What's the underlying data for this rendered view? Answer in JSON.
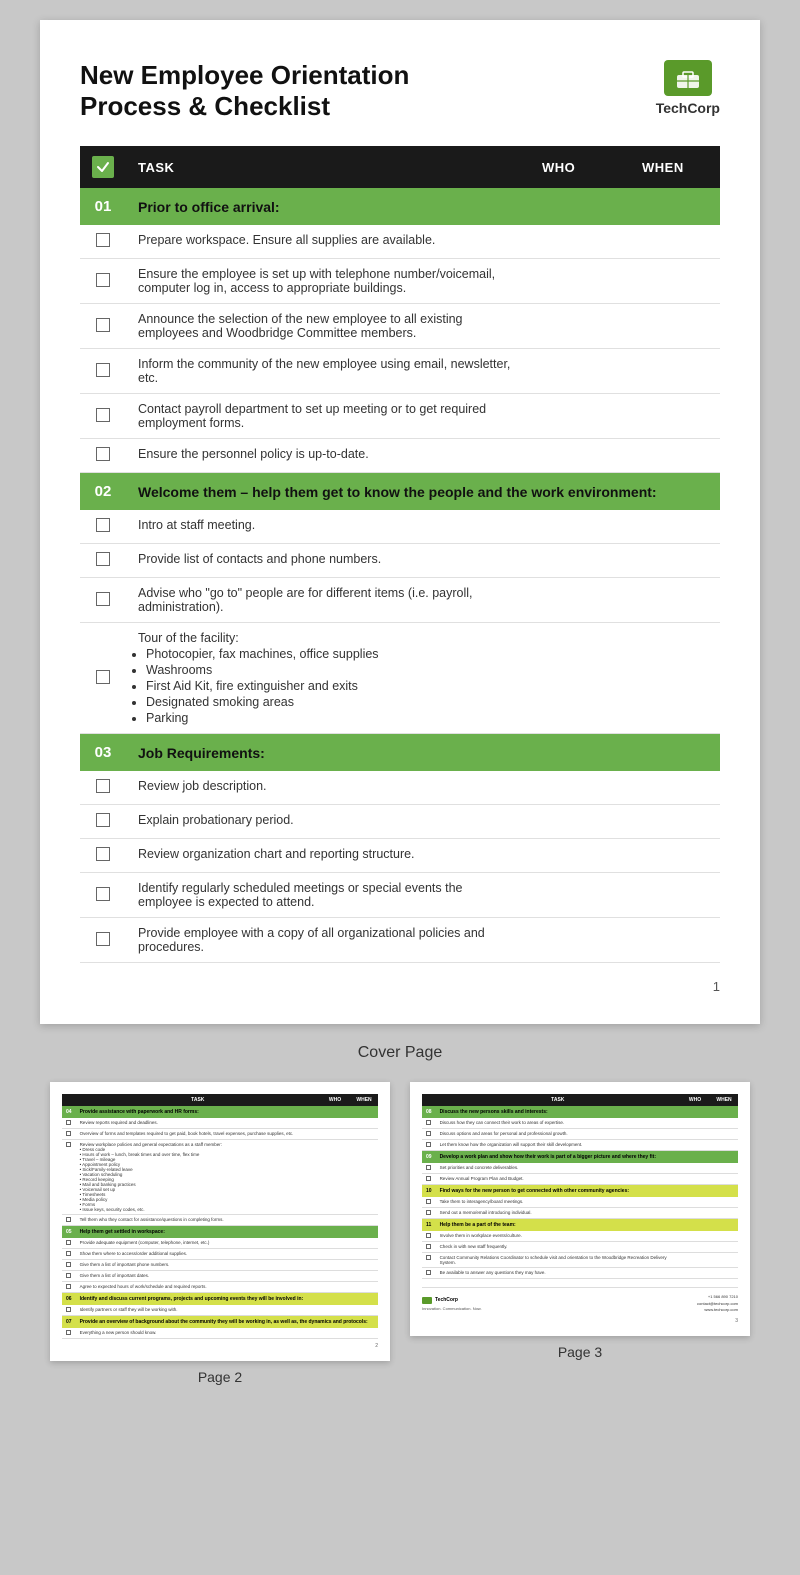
{
  "header": {
    "title_line1": "New Employee Orientation",
    "title_line2": "Process & Checklist",
    "logo_name": "TechCorp",
    "logo_alt": "briefcase-icon"
  },
  "table": {
    "columns": [
      "check",
      "TASK",
      "WHO",
      "WHEN"
    ],
    "sections": [
      {
        "id": "01",
        "title": "Prior to office arrival:",
        "rows": [
          "Prepare workspace. Ensure all supplies are available.",
          "Ensure the employee is set up with telephone number/voicemail, computer log in, access to appropriate buildings.",
          "Announce the selection of the new employee to all existing employees and Woodbridge Committee members.",
          "Inform the community of the new employee using email, newsletter, etc.",
          "Contact payroll department to set up meeting or to get required employment forms.",
          "Ensure the personnel policy is up-to-date."
        ]
      },
      {
        "id": "02",
        "title": "Welcome them – help them get to know the people and the work environment:",
        "rows": [
          "Intro at staff meeting.",
          "Provide list of contacts and phone numbers.",
          "Advise who \"go to\" people are for different items (i.e. payroll, administration).",
          "tour"
        ]
      },
      {
        "id": "03",
        "title": "Job Requirements:",
        "rows": [
          "Review job description.",
          "Explain probationary period.",
          "Review organization chart and reporting structure.",
          "Identify regularly scheduled meetings or special events the employee is expected to attend.",
          "Provide employee with a copy of all organizational policies and procedures."
        ]
      }
    ],
    "tour_row": {
      "main": "Tour of the facility:",
      "bullets": [
        "Photocopier, fax machines, office supplies",
        "Washrooms",
        "First Aid Kit, fire extinguisher and exits",
        "Designated smoking areas",
        "Parking"
      ]
    }
  },
  "page_number": "1",
  "cover_label": "Cover Page",
  "page2_label": "Page 2",
  "page3_label": "Page 3",
  "page2": {
    "sections": [
      {
        "id": "04",
        "title": "Provide assistance with paperwork and HR forms:",
        "color": "green",
        "rows": [
          "Review reports required and deadlines.",
          "Overview of forms and templates required to get paid, book hotels, travel expenses, purchase supplies, etc.",
          "Review workplace policies and general expectations as a staff member: Dress code, Hours of work, lunch, break times and over time, flex time, Travel – mileage, Appointment policy, Sick/family-related leave, Vacation scheduling, Record keeping, Mail and banking practices, Voicemail set up, Timesheets, Media policy, Forms, Issue keys, security codes, etc.",
          "Tell them who they contact for assistance/questions in completing forms."
        ]
      },
      {
        "id": "05",
        "title": "Help them get settled in workspace:",
        "color": "green",
        "rows": [
          "Provide adequate equipment (computer, telephone, internet, etc.)",
          "Show them where to access/order additional supplies.",
          "Give them a list of important phone numbers.",
          "Give them a list of important dates.",
          "Agree to expected hours of work/schedule and required reports."
        ]
      },
      {
        "id": "06",
        "title": "Identify and discuss current programs, projects and upcoming events they will be involved in:",
        "color": "yellow",
        "rows": [
          "Identify partners or staff they will be working with."
        ]
      },
      {
        "id": "07",
        "title": "Provide an overview of background about the community they will be working in, as well as, the dynamics and protocols:",
        "color": "yellow",
        "rows": [
          "Everything a new person should know."
        ]
      }
    ],
    "page_number": "2"
  },
  "page3": {
    "sections": [
      {
        "id": "08",
        "title": "Discuss the new persons skills and interests:",
        "color": "green",
        "rows": [
          "Discuss how they can connect their work to areas of expertise.",
          "Discuss options and areas for personal and professional growth.",
          "Let them know how the organization will support their skill development."
        ]
      },
      {
        "id": "09",
        "title": "Develop a work plan and show how their work is part of a bigger picture and where they fit:",
        "color": "green",
        "rows": [
          "Set priorities and concrete deliverables.",
          "Review Annual Program Plan and Budget."
        ]
      },
      {
        "id": "10",
        "title": "Find ways for the new person to get connected with other community agencies:",
        "color": "yellow",
        "rows": [
          "Take them to interagency/board meetings.",
          "Send out a memo/email introducing individual."
        ]
      },
      {
        "id": "11",
        "title": "Help them be a part of the team:",
        "color": "yellow",
        "rows": [
          "Involve them in workplace events/culture.",
          "Check in with new staff frequently.",
          "Contact Community Relations Coordinator to schedule visit and orientation to the Woodbridge Recreation Delivery System.",
          "Be available to answer any questions they may have."
        ]
      }
    ],
    "footer": {
      "brand": "TechCorp",
      "tagline": "Innovation. Communication. Now.",
      "phone": "+1 566 890 7210",
      "email": "contact@techcorp.com",
      "website": "www.techcorp.com"
    },
    "page_number": "3"
  },
  "colors": {
    "green_section": "#6ab04c",
    "yellow_section": "#d4e04a",
    "header_bg": "#1a1a1a",
    "logo_green": "#5a9a2a"
  }
}
